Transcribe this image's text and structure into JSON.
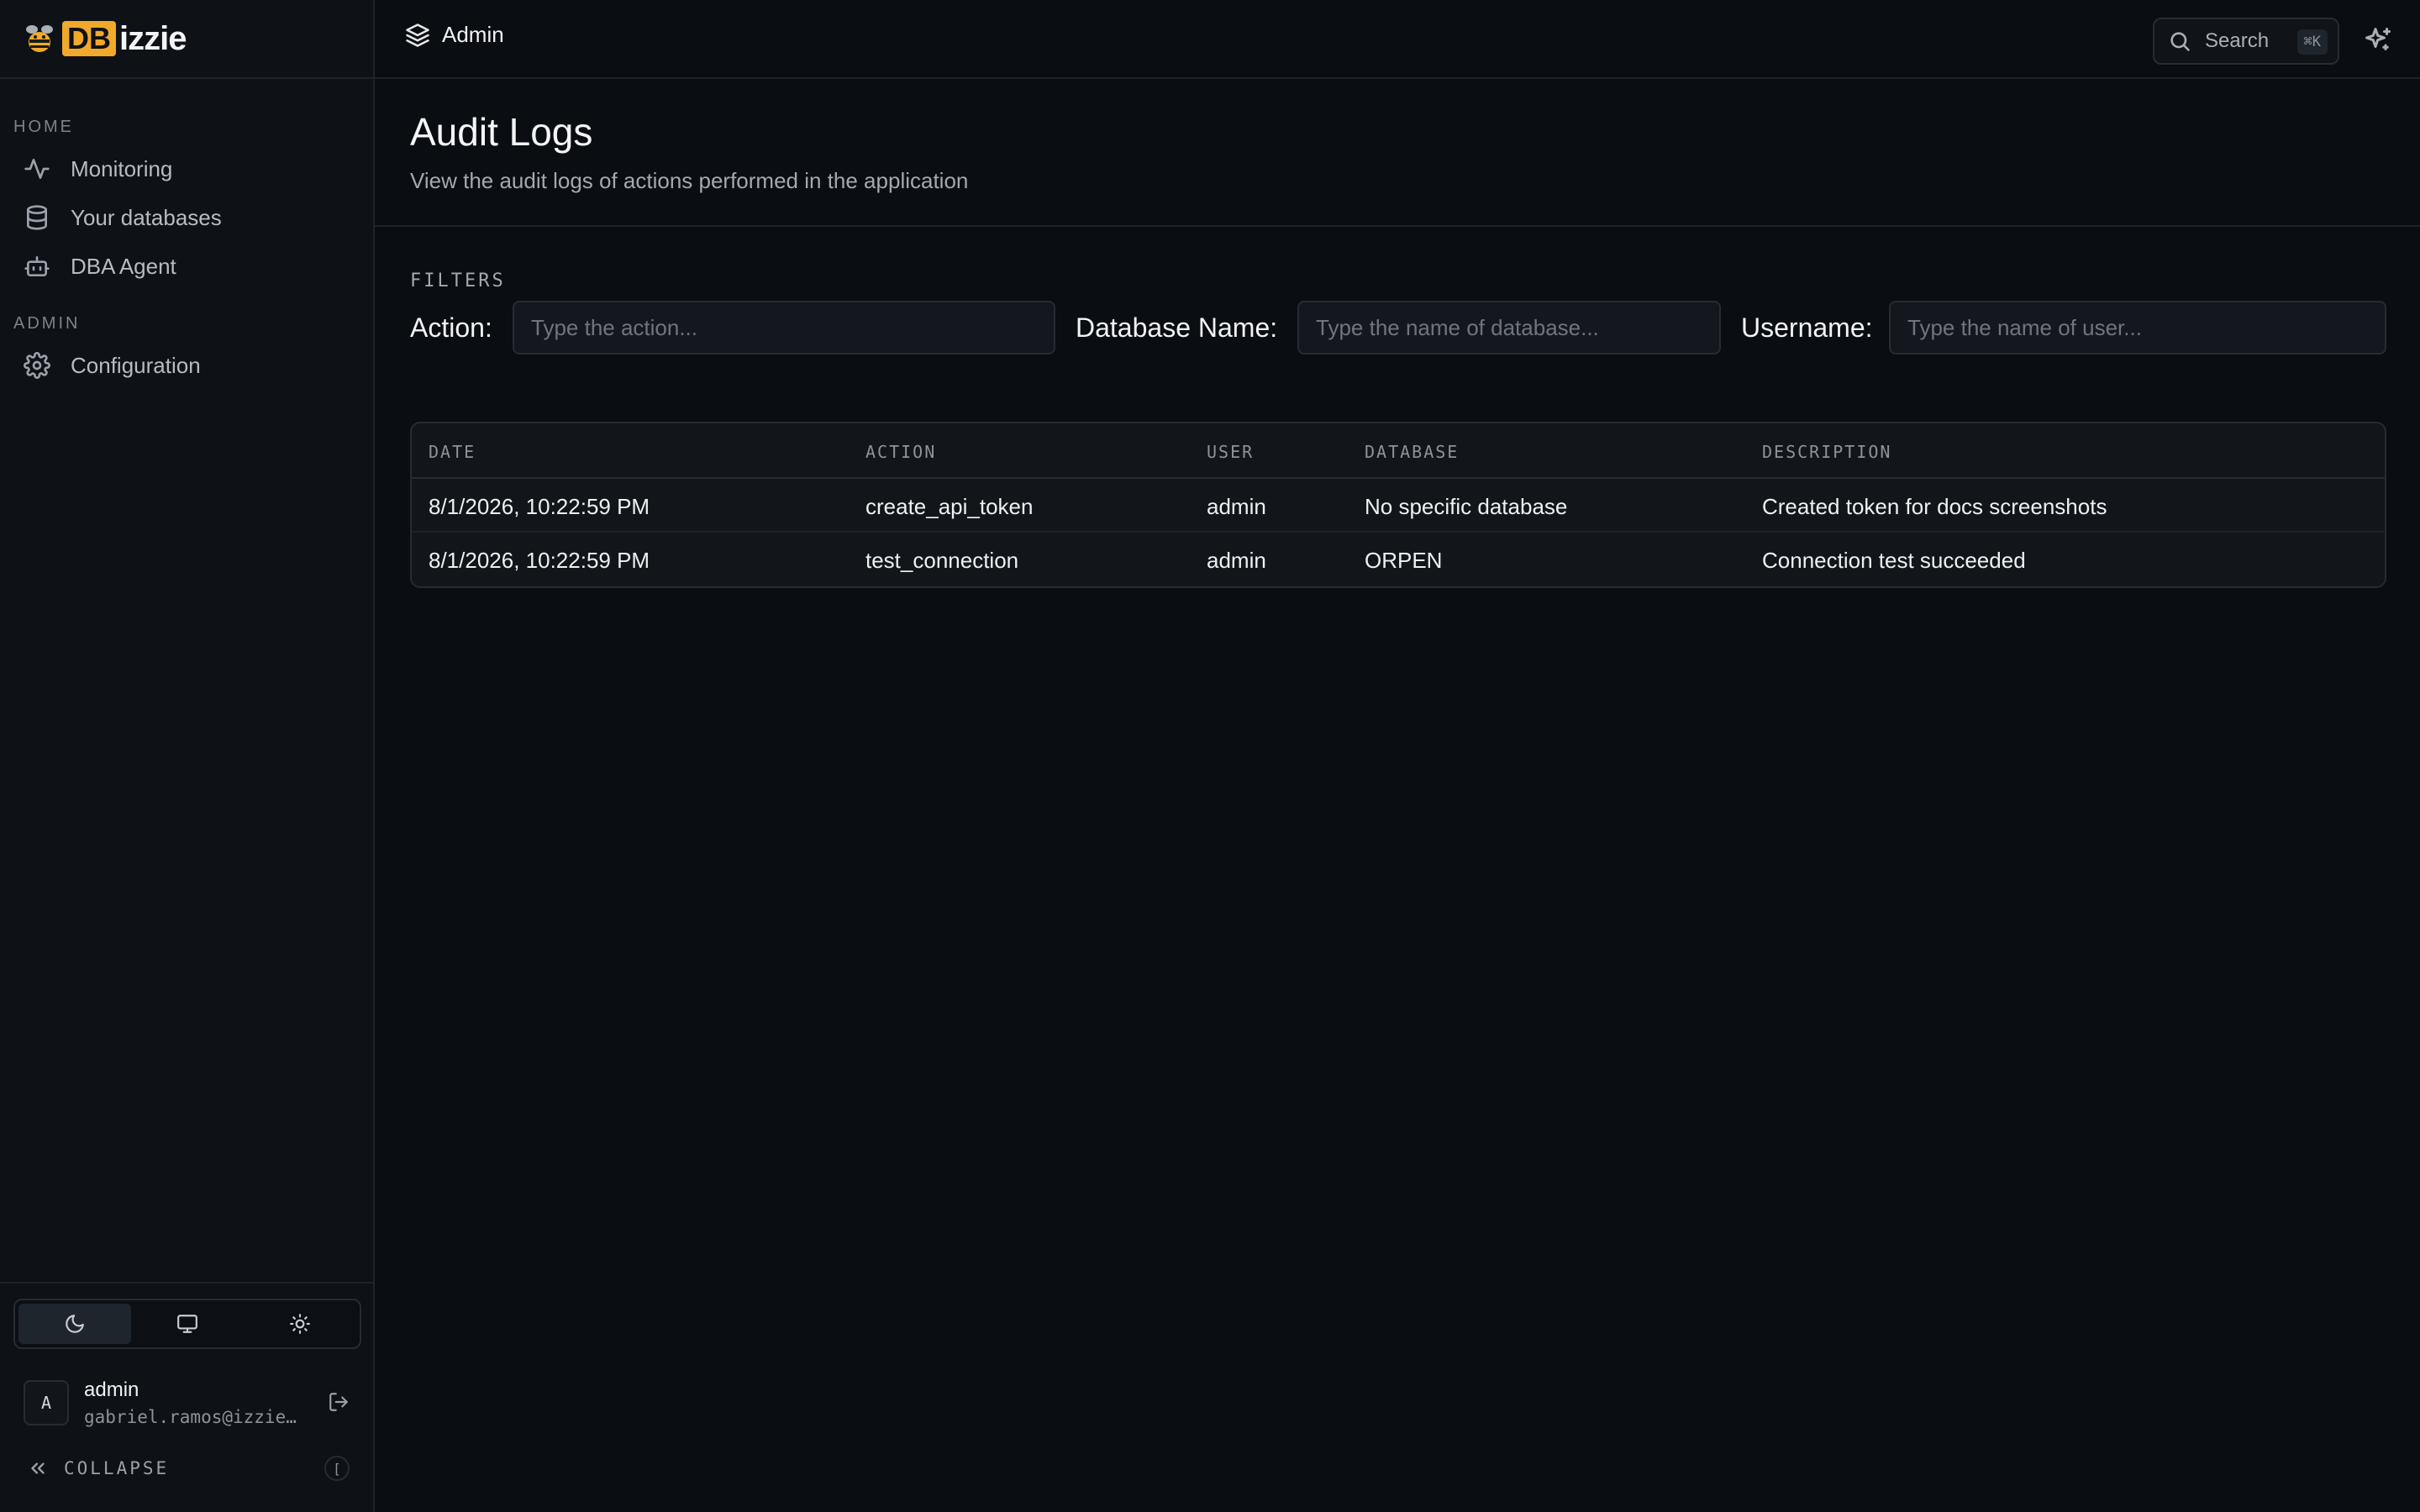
{
  "app": {
    "logo_badge": "DB",
    "logo_rest": "izzie"
  },
  "sidebar": {
    "sections": [
      {
        "label": "HOME",
        "items": [
          {
            "label": "Monitoring",
            "icon": "activity-icon"
          },
          {
            "label": "Your databases",
            "icon": "database-icon"
          },
          {
            "label": "DBA Agent",
            "icon": "bot-icon"
          }
        ]
      },
      {
        "label": "ADMIN",
        "items": [
          {
            "label": "Configuration",
            "icon": "gear-icon"
          }
        ]
      }
    ],
    "theme_options": [
      "moon-icon",
      "monitor-icon",
      "sun-icon"
    ],
    "theme_active": "moon-icon",
    "user": {
      "avatar_initial": "A",
      "name": "admin",
      "email": "gabriel.ramos@izzie…"
    },
    "collapse_label": "COLLAPSE",
    "collapse_shortcut": "["
  },
  "topbar": {
    "breadcrumb": "Admin",
    "search_label": "Search",
    "search_shortcut": "⌘K"
  },
  "page": {
    "title": "Audit Logs",
    "subtitle": "View the audit logs of actions performed in the application"
  },
  "filters": {
    "section_label": "FILTERS",
    "action_label": "Action:",
    "action_placeholder": "Type the action...",
    "database_label": "Database Name:",
    "database_placeholder": "Type the name of database...",
    "username_label": "Username:",
    "username_placeholder": "Type the name of user..."
  },
  "table": {
    "columns": [
      "DATE",
      "ACTION",
      "USER",
      "DATABASE",
      "DESCRIPTION"
    ],
    "rows": [
      [
        "8/1/2026, 10:22:59 PM",
        "create_api_token",
        "admin",
        "No specific database",
        "Created token for docs screenshots"
      ],
      [
        "8/1/2026, 10:22:59 PM",
        "test_connection",
        "admin",
        "ORPEN",
        "Connection test succeeded"
      ]
    ]
  },
  "colors": {
    "accent": "#f0a92a",
    "background": "#0a0d11",
    "sidebar": "#0e1116"
  }
}
